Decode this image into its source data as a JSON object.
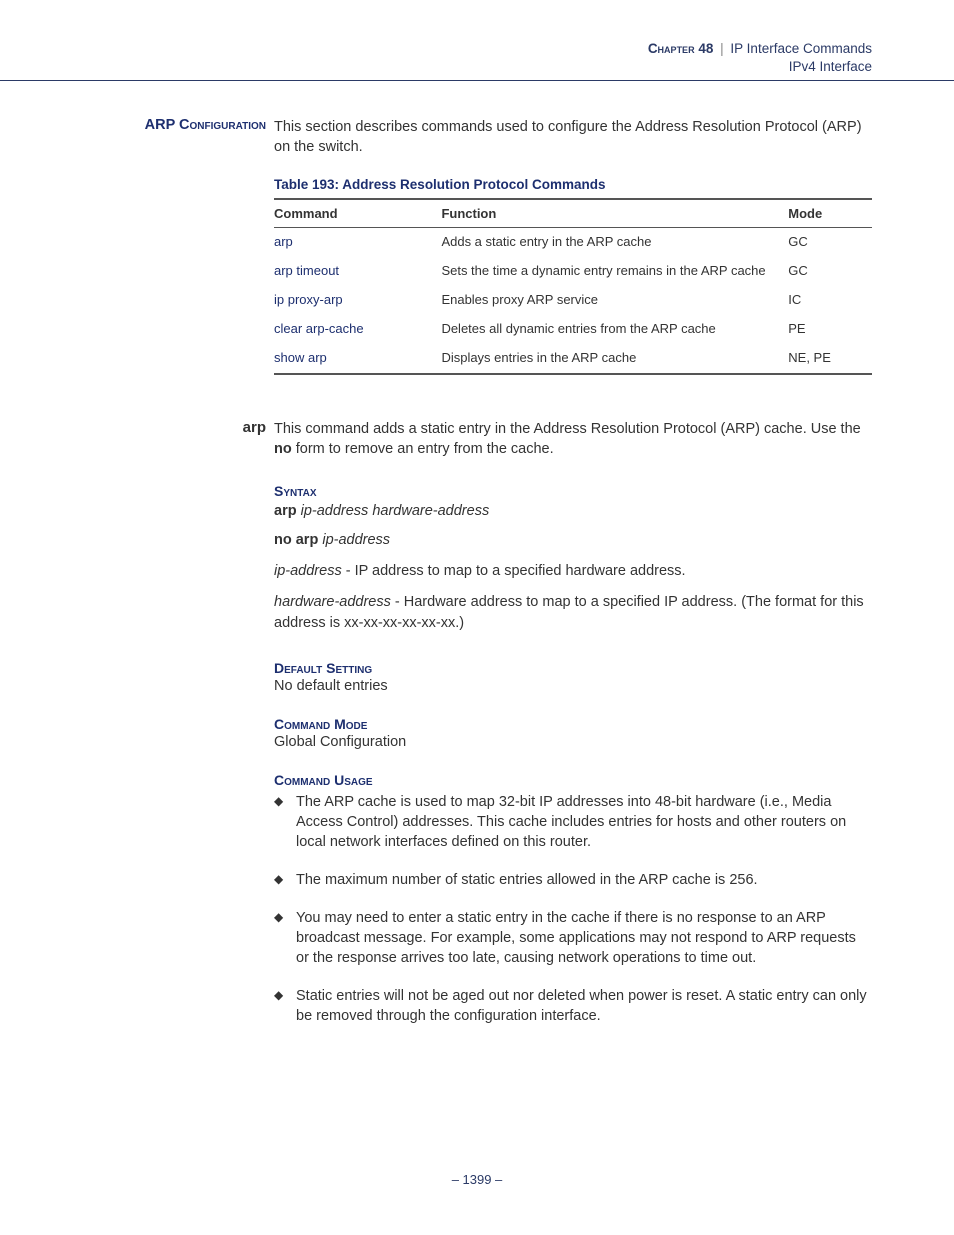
{
  "header": {
    "chapter_prefix": "Chapter",
    "chapter_number": "48",
    "divider": "|",
    "chapter_title": "IP Interface Commands",
    "subtitle": "IPv4 Interface"
  },
  "section": {
    "label_prefix": "ARP C",
    "label_suffix": "onfiguration",
    "intro": "This section describes commands used to configure the Address Resolution Protocol (ARP) on the switch."
  },
  "table": {
    "title": "Table 193: Address Resolution Protocol Commands",
    "headers": {
      "c1": "Command",
      "c2": "Function",
      "c3": "Mode"
    },
    "rows": [
      {
        "cmd": "arp",
        "fn": "Adds a static entry in the ARP cache",
        "mode": "GC"
      },
      {
        "cmd": "arp timeout",
        "fn": "Sets the time a dynamic entry remains in the ARP cache",
        "mode": "GC"
      },
      {
        "cmd": "ip proxy-arp",
        "fn": "Enables proxy ARP service",
        "mode": "IC"
      },
      {
        "cmd": "clear arp-cache",
        "fn": "Deletes all dynamic entries from the ARP cache",
        "mode": "PE"
      },
      {
        "cmd": "show arp",
        "fn": "Displays entries in the ARP cache",
        "mode": "NE, PE"
      }
    ]
  },
  "command": {
    "name": "arp",
    "desc_a": "This command adds a static entry in the Address Resolution Protocol (ARP) cache. Use the ",
    "desc_bold": "no",
    "desc_b": " form to remove an entry from the cache.",
    "syntax_head": "Syntax",
    "syntax1_bold": "arp",
    "syntax1_ital": " ip-address hardware-address",
    "syntax2_bold": "no arp",
    "syntax2_ital": " ip-address",
    "param1_ital": "ip-address",
    "param1_rest": " - IP address to map to a specified hardware address.",
    "param2_ital": "hardware-address",
    "param2_rest": " - Hardware address to map to a specified IP address. (The format for this address is xx-xx-xx-xx-xx-xx.)",
    "default_head": "Default Setting",
    "default_text": "No default entries",
    "mode_head": "Command Mode",
    "mode_text": "Global Configuration",
    "usage_head": "Command Usage",
    "usage": [
      "The ARP cache is used to map 32-bit IP addresses into 48-bit hardware (i.e., Media Access Control) addresses. This cache includes entries for hosts and other routers on local network interfaces defined on this router.",
      "The maximum number of static entries allowed in the ARP cache is 256.",
      "You may need to enter a static entry in the cache if there is no response to an ARP broadcast message. For example, some applications may not respond to ARP requests or the response arrives too late, causing network operations to time out.",
      "Static entries will not be aged out nor deleted when power is reset. A static entry can only be removed through the configuration interface."
    ]
  },
  "footer": {
    "page": "–  1399  –"
  }
}
